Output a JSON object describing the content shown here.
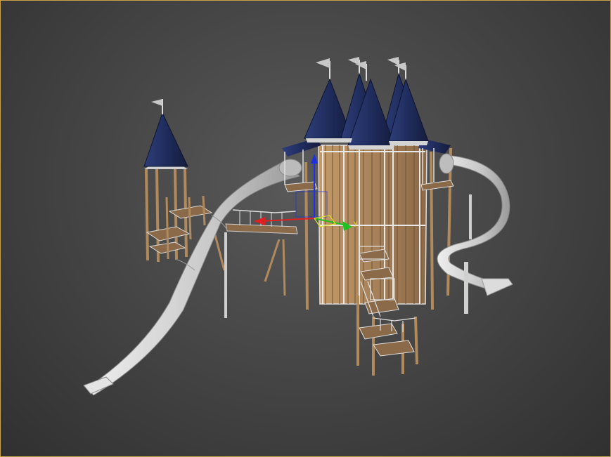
{
  "viewport": {
    "border_color": "#c8a24a",
    "background_center": "#5a5a5a",
    "background_edge": "#303030"
  },
  "scene": {
    "model": {
      "roof_color": "#1f2c5c",
      "wood_color": "#b08a5c",
      "slide_color": "#cfcfcf",
      "metal_color": "#d8d8d8"
    },
    "gizmo": {
      "x_axis_color": "#e02020",
      "y_axis_color": "#20c020",
      "z_axis_color": "#2030e0",
      "plane_color": "#e0e020",
      "x_label": "",
      "y_label": "y",
      "z_label": ""
    }
  }
}
